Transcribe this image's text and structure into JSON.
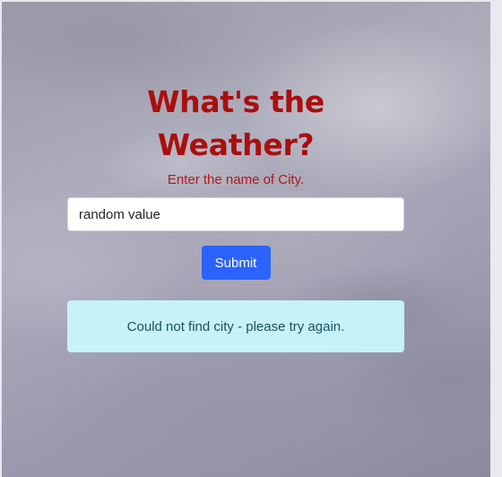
{
  "title": "What's the Weather?",
  "subtitle": "Enter the name of City.",
  "city_input": {
    "value": "random value",
    "placeholder": ""
  },
  "submit_label": "Submit",
  "alert_message": "Could not find city - please try again.",
  "colors": {
    "title": "#a90f0f",
    "button": "#2c63ff",
    "alert_background": "#c6f2f8",
    "alert_text": "#175262"
  }
}
